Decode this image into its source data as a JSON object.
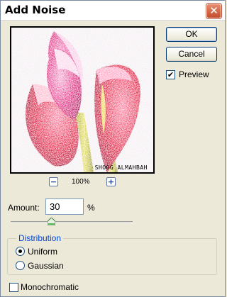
{
  "window": {
    "title": "Add Noise",
    "close_glyph": "✕"
  },
  "preview": {
    "watermark": "SHOOG ALMAHBAH",
    "zoom_level": "100%",
    "zoom_out_glyph": "−",
    "zoom_in_glyph": "+"
  },
  "buttons": {
    "ok": "OK",
    "cancel": "Cancel"
  },
  "preview_checkbox": {
    "label": "Preview",
    "checked": true,
    "glyph": "✔"
  },
  "amount": {
    "label": "Amount:",
    "value": "30",
    "unit": "%",
    "slider_value_percent": 30
  },
  "distribution": {
    "title": "Distribution",
    "options": [
      {
        "label": "Uniform",
        "selected": true
      },
      {
        "label": "Gaussian",
        "selected": false
      }
    ]
  },
  "monochromatic": {
    "label": "Monochromatic",
    "checked": false
  },
  "colors": {
    "accent_text": "#0046d5",
    "close_red": "#c24b2b",
    "flower_pink": "#e0247a",
    "stem_yellow": "#c8c236"
  }
}
